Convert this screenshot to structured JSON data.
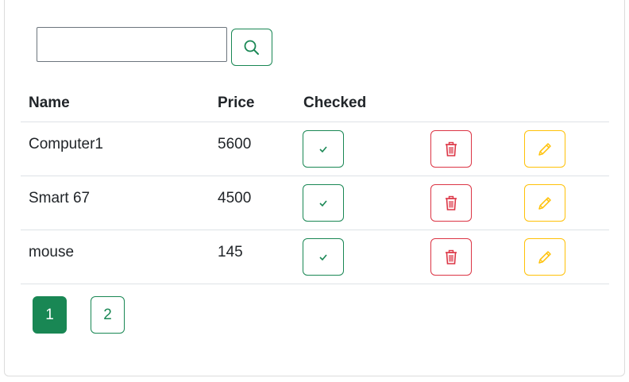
{
  "search": {
    "value": "",
    "placeholder": ""
  },
  "table": {
    "headers": {
      "name": "Name",
      "price": "Price",
      "checked": "Checked"
    },
    "rows": [
      {
        "name": "Computer1",
        "price": "5600"
      },
      {
        "name": "Smart 67",
        "price": "4500"
      },
      {
        "name": "mouse",
        "price": "145"
      }
    ]
  },
  "pagination": {
    "pages": [
      "1",
      "2"
    ],
    "current": "1"
  },
  "colors": {
    "success": "#198754",
    "danger": "#dc3545",
    "warning": "#ffc107"
  },
  "icons": {
    "search": "search-icon",
    "check": "check-icon",
    "delete": "trash-icon",
    "edit": "pencil-icon"
  }
}
